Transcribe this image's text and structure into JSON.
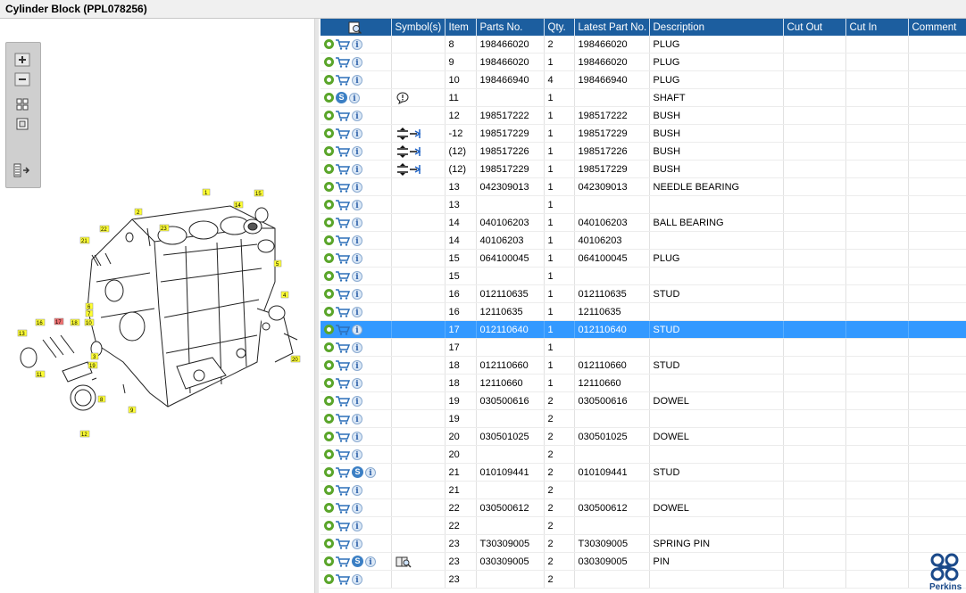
{
  "window": {
    "title": "Cylinder Block (PPL078256)"
  },
  "colors": {
    "header_bg": "#1c5e9f",
    "selected_row": "#3399ff",
    "gear_green": "#5aa52a",
    "brand_blue": "#1b4a8a"
  },
  "toolbox": {
    "icons": [
      "zoom-in-icon",
      "zoom-out-icon",
      "fit-grid-icon",
      "fit-page-icon",
      "expand-panel-icon"
    ]
  },
  "diagram": {
    "callouts": [
      "1",
      "2",
      "3",
      "4",
      "5",
      "6",
      "7",
      "8",
      "9",
      "10",
      "11",
      "12",
      "13",
      "14",
      "15",
      "16",
      "17",
      "18",
      "19",
      "20",
      "21",
      "22",
      "23"
    ],
    "highlighted_callout": "17"
  },
  "table": {
    "columns": [
      "",
      "Symbol(s)",
      "Item",
      "Parts No.",
      "Qty.",
      "Latest Part No.",
      "Description",
      "Cut Out",
      "Cut In",
      "Comment"
    ],
    "header_icon": "search-doc-icon",
    "rows": [
      {
        "item": "8",
        "part": "198466020",
        "qty": "2",
        "latest": "198466020",
        "desc": "PLUG",
        "s": false,
        "sym": "",
        "selected": false
      },
      {
        "item": "9",
        "part": "198466020",
        "qty": "1",
        "latest": "198466020",
        "desc": "PLUG",
        "s": false,
        "sym": "",
        "selected": false
      },
      {
        "item": "10",
        "part": "198466940",
        "qty": "4",
        "latest": "198466940",
        "desc": "PLUG",
        "s": false,
        "sym": "",
        "selected": false
      },
      {
        "item": "11",
        "part": "",
        "qty": "1",
        "latest": "",
        "desc": "SHAFT",
        "s": true,
        "sym": "note",
        "selected": false,
        "no_cart": true
      },
      {
        "item": "12",
        "part": "198517222",
        "qty": "1",
        "latest": "198517222",
        "desc": "BUSH",
        "s": false,
        "sym": "",
        "selected": false
      },
      {
        "item": "-12",
        "part": "198517229",
        "qty": "1",
        "latest": "198517229",
        "desc": "BUSH",
        "s": false,
        "sym": "interchange",
        "selected": false
      },
      {
        "item": "(12)",
        "part": "198517226",
        "qty": "1",
        "latest": "198517226",
        "desc": "BUSH",
        "s": false,
        "sym": "interchange",
        "selected": false
      },
      {
        "item": "(12)",
        "part": "198517229",
        "qty": "1",
        "latest": "198517229",
        "desc": "BUSH",
        "s": false,
        "sym": "interchange",
        "selected": false
      },
      {
        "item": "13",
        "part": "042309013",
        "qty": "1",
        "latest": "042309013",
        "desc": "NEEDLE BEARING",
        "s": false,
        "sym": "",
        "selected": false
      },
      {
        "item": "13",
        "part": "",
        "qty": "1",
        "latest": "",
        "desc": "",
        "s": false,
        "sym": "",
        "selected": false
      },
      {
        "item": "14",
        "part": "040106203",
        "qty": "1",
        "latest": "040106203",
        "desc": "BALL BEARING",
        "s": false,
        "sym": "",
        "selected": false
      },
      {
        "item": "14",
        "part": "40106203",
        "qty": "1",
        "latest": "40106203",
        "desc": "",
        "s": false,
        "sym": "",
        "selected": false
      },
      {
        "item": "15",
        "part": "064100045",
        "qty": "1",
        "latest": "064100045",
        "desc": "PLUG",
        "s": false,
        "sym": "",
        "selected": false
      },
      {
        "item": "15",
        "part": "",
        "qty": "1",
        "latest": "",
        "desc": "",
        "s": false,
        "sym": "",
        "selected": false
      },
      {
        "item": "16",
        "part": "012110635",
        "qty": "1",
        "latest": "012110635",
        "desc": "STUD",
        "s": false,
        "sym": "",
        "selected": false
      },
      {
        "item": "16",
        "part": "12110635",
        "qty": "1",
        "latest": "12110635",
        "desc": "",
        "s": false,
        "sym": "",
        "selected": false
      },
      {
        "item": "17",
        "part": "012110640",
        "qty": "1",
        "latest": "012110640",
        "desc": "STUD",
        "s": false,
        "sym": "",
        "selected": true
      },
      {
        "item": "17",
        "part": "",
        "qty": "1",
        "latest": "",
        "desc": "",
        "s": false,
        "sym": "",
        "selected": false
      },
      {
        "item": "18",
        "part": "012110660",
        "qty": "1",
        "latest": "012110660",
        "desc": "STUD",
        "s": false,
        "sym": "",
        "selected": false
      },
      {
        "item": "18",
        "part": "12110660",
        "qty": "1",
        "latest": "12110660",
        "desc": "",
        "s": false,
        "sym": "",
        "selected": false
      },
      {
        "item": "19",
        "part": "030500616",
        "qty": "2",
        "latest": "030500616",
        "desc": "DOWEL",
        "s": false,
        "sym": "",
        "selected": false
      },
      {
        "item": "19",
        "part": "",
        "qty": "2",
        "latest": "",
        "desc": "",
        "s": false,
        "sym": "",
        "selected": false
      },
      {
        "item": "20",
        "part": "030501025",
        "qty": "2",
        "latest": "030501025",
        "desc": "DOWEL",
        "s": false,
        "sym": "",
        "selected": false
      },
      {
        "item": "20",
        "part": "",
        "qty": "2",
        "latest": "",
        "desc": "",
        "s": false,
        "sym": "",
        "selected": false
      },
      {
        "item": "21",
        "part": "010109441",
        "qty": "2",
        "latest": "010109441",
        "desc": "STUD",
        "s": true,
        "sym": "",
        "selected": false
      },
      {
        "item": "21",
        "part": "",
        "qty": "2",
        "latest": "",
        "desc": "",
        "s": false,
        "sym": "",
        "selected": false
      },
      {
        "item": "22",
        "part": "030500612",
        "qty": "2",
        "latest": "030500612",
        "desc": "DOWEL",
        "s": false,
        "sym": "",
        "selected": false
      },
      {
        "item": "22",
        "part": "",
        "qty": "2",
        "latest": "",
        "desc": "",
        "s": false,
        "sym": "",
        "selected": false
      },
      {
        "item": "23",
        "part": "T30309005",
        "qty": "2",
        "latest": "T30309005",
        "desc": "SPRING PIN",
        "s": false,
        "sym": "",
        "selected": false
      },
      {
        "item": "23",
        "part": "030309005",
        "qty": "2",
        "latest": "030309005",
        "desc": "PIN",
        "s": true,
        "sym": "book",
        "selected": false
      },
      {
        "item": "23",
        "part": "",
        "qty": "2",
        "latest": "",
        "desc": "",
        "s": false,
        "sym": "",
        "selected": false
      }
    ]
  },
  "brand": {
    "name": "Perkins"
  }
}
